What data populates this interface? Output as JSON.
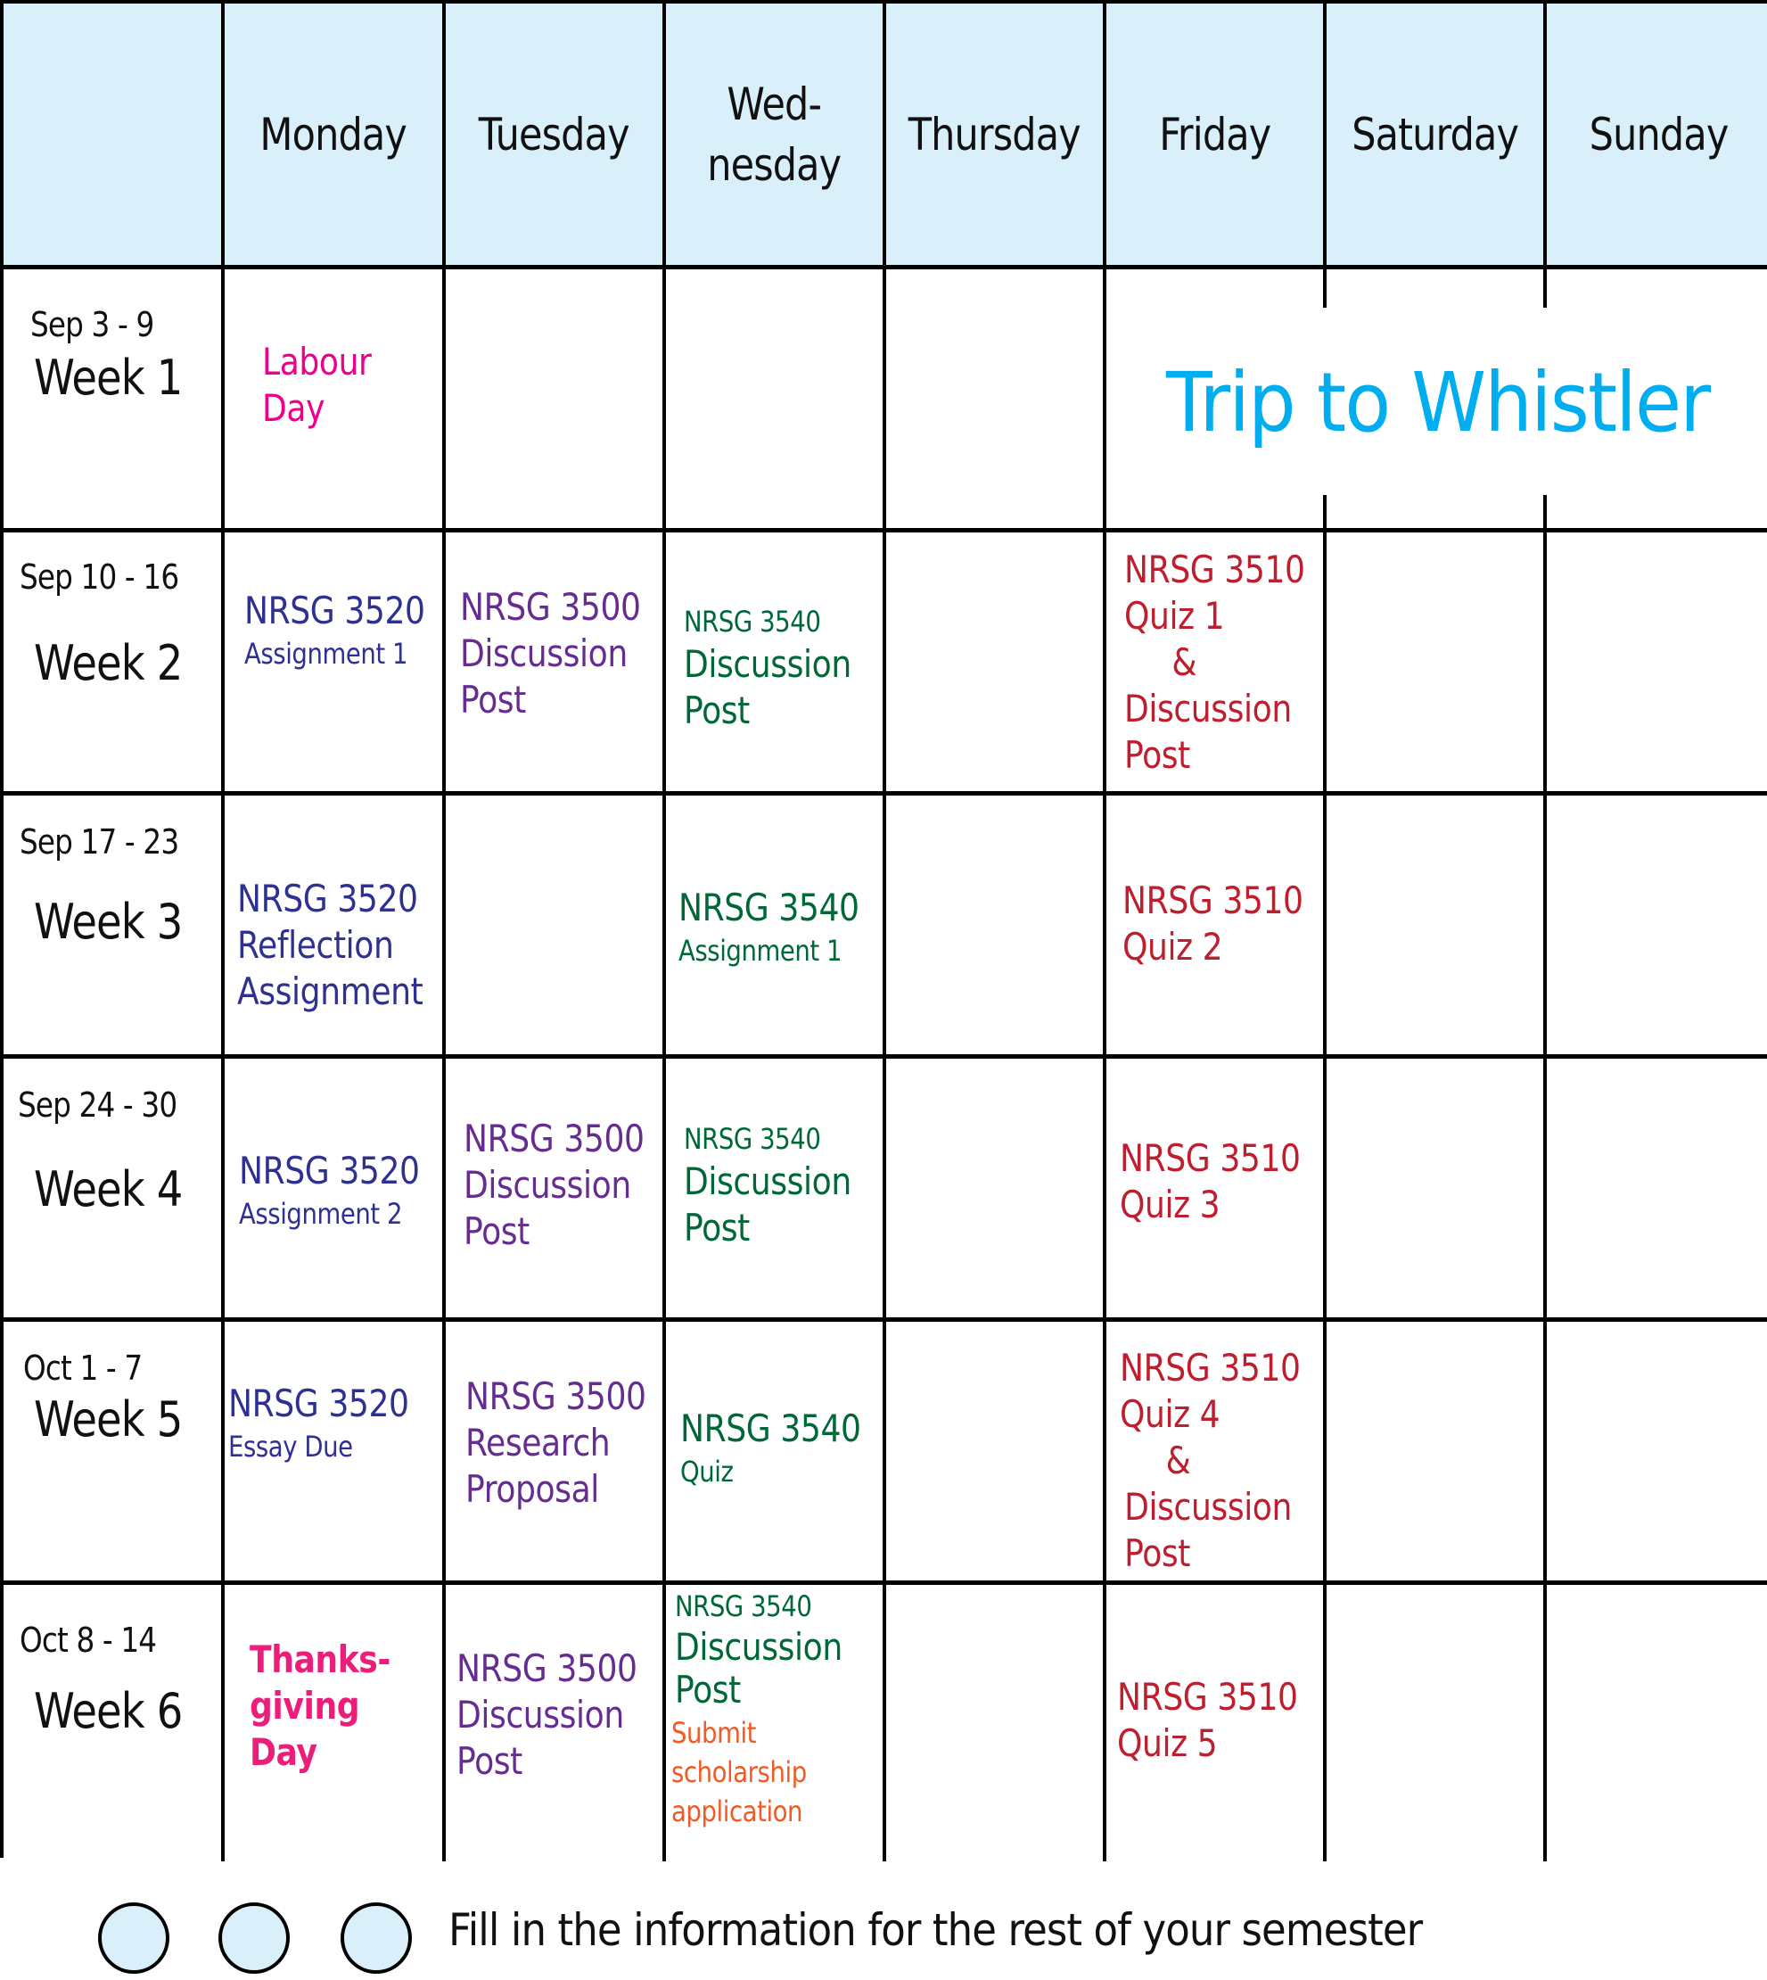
{
  "calendar": {
    "header": {
      "corner": "",
      "days": [
        "Monday",
        "Tuesday",
        "Wed-\nnesday",
        "Thursday",
        "Friday",
        "Saturday",
        "Sunday"
      ]
    },
    "weeks": [
      {
        "dates": "Sep 3 - 9",
        "name": "Week 1",
        "monday": [
          "Labour",
          "Day"
        ],
        "event_span": "Trip to Whistler"
      },
      {
        "dates": "Sep 10 - 16",
        "name": "Week 2",
        "monday": [
          "NRSG 3520",
          "Assignment 1"
        ],
        "tuesday": [
          "NRSG 3500",
          "Discussion",
          "Post"
        ],
        "wednesday": [
          "NRSG 3540",
          "Discussion",
          "Post"
        ],
        "friday": [
          "NRSG 3510",
          "Quiz 1",
          "&",
          "Discussion",
          "Post"
        ]
      },
      {
        "dates": "Sep 17 - 23",
        "name": "Week 3",
        "monday": [
          "NRSG 3520",
          "Reflection",
          "Assignment"
        ],
        "wednesday": [
          "NRSG 3540",
          "Assignment 1"
        ],
        "friday": [
          "NRSG 3510",
          "Quiz 2"
        ]
      },
      {
        "dates": "Sep 24 - 30",
        "name": "Week 4",
        "monday": [
          "NRSG 3520",
          "Assignment 2"
        ],
        "tuesday": [
          "NRSG 3500",
          "Discussion",
          "Post"
        ],
        "wednesday": [
          "NRSG 3540",
          "Discussion",
          "Post"
        ],
        "friday": [
          "NRSG 3510",
          "Quiz 3"
        ]
      },
      {
        "dates": "Oct 1 - 7",
        "name": "Week 5",
        "monday": [
          "NRSG 3520",
          "Essay Due"
        ],
        "tuesday": [
          "NRSG 3500",
          "Research",
          "Proposal"
        ],
        "wednesday": [
          "NRSG 3540",
          "Quiz"
        ],
        "friday": [
          "NRSG 3510",
          "Quiz 4",
          "&",
          "Discussion",
          "Post"
        ]
      },
      {
        "dates": "Oct 8 - 14",
        "name": "Week 6",
        "monday": [
          "Thanks-",
          "giving",
          "Day"
        ],
        "tuesday": [
          "NRSG 3500",
          "Discussion",
          "Post"
        ],
        "wednesday": [
          "NRSG 3540",
          "Discussion",
          "Post"
        ],
        "wednesday_extra": [
          "Submit",
          "scholarship",
          "application"
        ],
        "friday": [
          "NRSG 3510",
          "Quiz 5"
        ]
      }
    ]
  },
  "footer": {
    "legend_dots": 3,
    "instruction": "Fill in the information for the rest of your semester"
  },
  "colors": {
    "header_bg": "#d9eff9",
    "nrsg_3520": "#2e3192",
    "nrsg_3500": "#662d91",
    "nrsg_3540": "#006837",
    "nrsg_3510": "#be1e2d",
    "holiday": "#ec008c",
    "scholarship": "#f15a24",
    "trip": "#00aeef"
  }
}
